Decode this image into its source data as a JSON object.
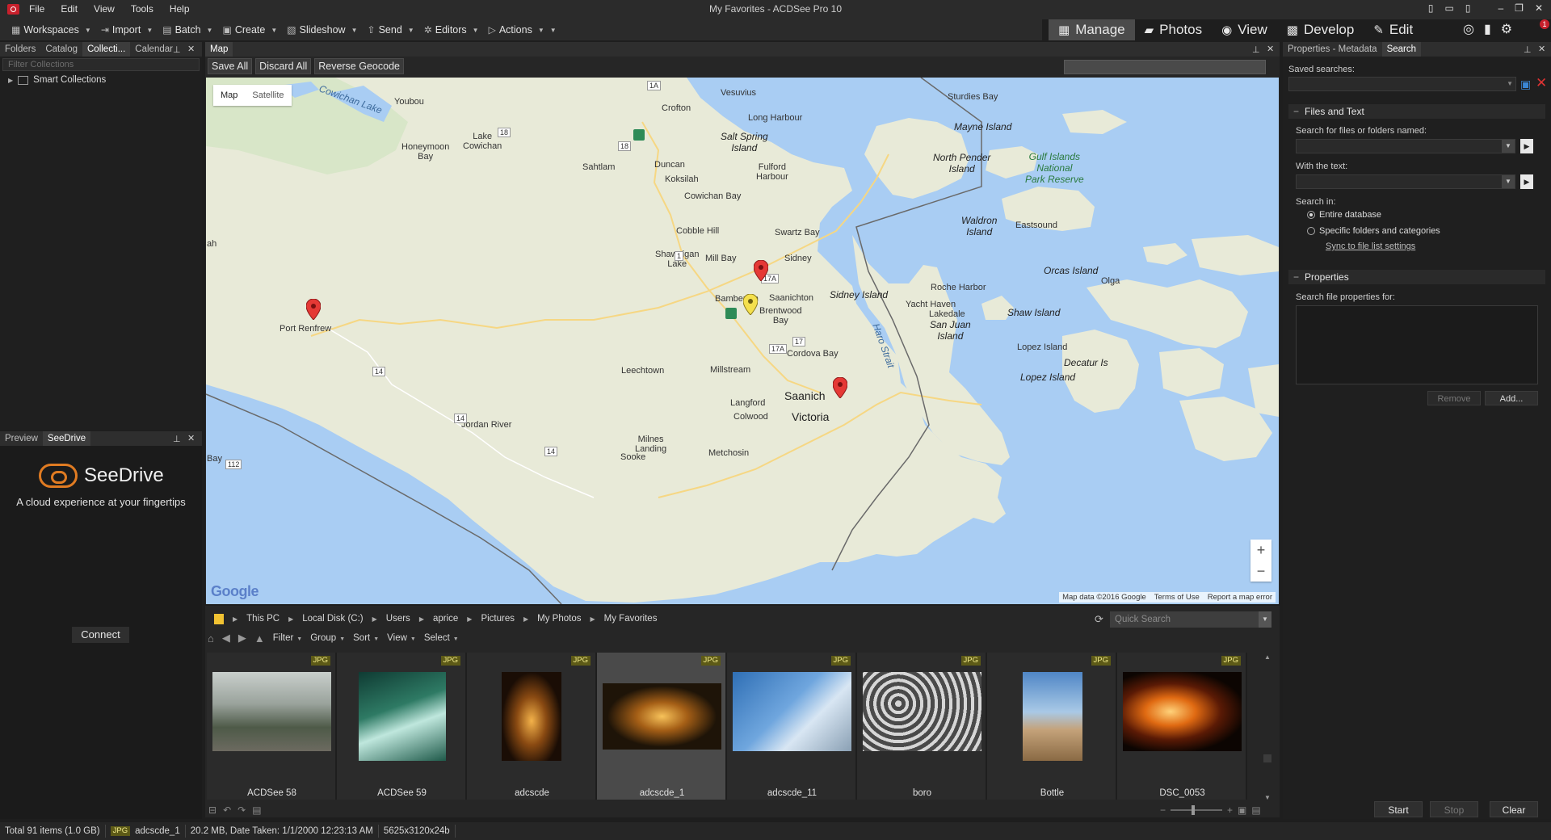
{
  "titlebar": {
    "title": "My Favorites - ACDSee Pro 10",
    "menu": [
      "File",
      "Edit",
      "View",
      "Tools",
      "Help"
    ]
  },
  "toolbar": {
    "items": [
      {
        "label": "Workspaces",
        "icon": "workspaces-icon"
      },
      {
        "label": "Import",
        "icon": "import-icon"
      },
      {
        "label": "Batch",
        "icon": "batch-icon"
      },
      {
        "label": "Create",
        "icon": "create-icon"
      },
      {
        "label": "Slideshow",
        "icon": "slideshow-icon"
      },
      {
        "label": "Send",
        "icon": "send-icon"
      },
      {
        "label": "Editors",
        "icon": "editors-icon"
      },
      {
        "label": "Actions",
        "icon": "actions-icon"
      }
    ]
  },
  "modes": [
    {
      "label": "Manage",
      "icon": "grid-icon",
      "active": true
    },
    {
      "label": "Photos",
      "icon": "photos-icon",
      "active": false
    },
    {
      "label": "View",
      "icon": "eye-icon",
      "active": false
    },
    {
      "label": "Develop",
      "icon": "develop-icon",
      "active": false
    },
    {
      "label": "Edit",
      "icon": "edit-icon",
      "active": false
    }
  ],
  "notification_count": "1",
  "left_top": {
    "tabs": [
      "Folders",
      "Catalog",
      "Collecti...",
      "Calendar"
    ],
    "active_tab": 2,
    "filter_placeholder": "Filter Collections",
    "tree_item": "Smart Collections"
  },
  "left_bottom": {
    "tabs": [
      "Preview",
      "SeeDrive"
    ],
    "active_tab": 1,
    "brand": "SeeDrive",
    "tagline": "A cloud experience at your fingertips",
    "connect_label": "Connect"
  },
  "map": {
    "panel_title": "Map",
    "actions": [
      "Save All",
      "Discard All",
      "Reverse Geocode"
    ],
    "map_types": [
      "Map",
      "Satellite"
    ],
    "zoom_in": "+",
    "zoom_out": "−",
    "logo": "Google",
    "attribution": [
      "Map data ©2016 Google",
      "Terms of Use",
      "Report a map error"
    ],
    "labels": {
      "youbou": "Youbou",
      "cowichan_lake_water": "Cowichan Lake",
      "lake_cowichan": "Lake\nCowichan",
      "honeymoon_bay": "Honeymoon\nBay",
      "crofton": "Crofton",
      "vesuvius": "Vesuvius",
      "sturdies_bay": "Sturdies Bay",
      "long_harbour": "Long Harbour",
      "mayne_island": "Mayne Island",
      "salt_spring": "Salt Spring\nIsland",
      "north_pender": "North Pender\nIsland",
      "gulf_islands": "Gulf Islands\nNational\nPark Reserve",
      "sahtlam": "Sahtlam",
      "duncan": "Duncan",
      "koksilah": "Koksilah",
      "fulford": "Fulford\nHarbour",
      "cowichan_bay": "Cowichan Bay",
      "waldron": "Waldron\nIsland",
      "eastsound": "Eastsound",
      "cobble_hill": "Cobble Hill",
      "swartz_bay": "Swartz Bay",
      "sidney": "Sidney",
      "shawnigan": "Shawnigan\nLake",
      "mill_bay": "Mill Bay",
      "orcas": "Orcas Island",
      "olga": "Olga",
      "roche": "Roche Harbor",
      "sidney_island": "Sidney Island",
      "saanichton": "Saanichton",
      "bamberton": "Bamberton",
      "brentwood": "Brentwood\nBay",
      "yacht_haven": "Yacht Haven",
      "port_renfrew": "Port Renfrew",
      "lakedale": "Lakedale",
      "san_juan": "San Juan\nIsland",
      "shaw": "Shaw Island",
      "cordova": "Cordova Bay",
      "haro": "Haro Strait",
      "lopez_island_n": "Lopez Island",
      "decatur": "Decatur Is",
      "lopez_island": "Lopez Island",
      "leechtown": "Leechtown",
      "millstream": "Millstream",
      "saanich": "Saanich",
      "langford": "Langford",
      "colwood": "Colwood",
      "victoria": "Victoria",
      "jordan_river": "Jordan River",
      "milnes": "Milnes\nLanding",
      "metchosin": "Metchosin",
      "sooke": "Sooke",
      "bay": "Bay",
      "ah": "ah"
    },
    "shields": [
      "1A",
      "18",
      "18",
      "1",
      "17A",
      "17",
      "17A",
      "14",
      "14",
      "14",
      "112"
    ]
  },
  "browser": {
    "breadcrumb": [
      "This PC",
      "Local Disk (C:)",
      "Users",
      "aprice",
      "Pictures",
      "My Photos",
      "My Favorites"
    ],
    "quick_search_placeholder": "Quick Search",
    "tools": [
      "Filter",
      "Group",
      "Sort",
      "View",
      "Select"
    ],
    "thumbnails": [
      {
        "name": "ACDSee 58",
        "type": "JPG",
        "selected": false
      },
      {
        "name": "ACDSee 59",
        "type": "JPG",
        "selected": false
      },
      {
        "name": "adcscde",
        "type": "JPG",
        "selected": false
      },
      {
        "name": "adcscde_1",
        "type": "JPG",
        "selected": true
      },
      {
        "name": "adcscde_11",
        "type": "JPG",
        "selected": false
      },
      {
        "name": "boro",
        "type": "JPG",
        "selected": false
      },
      {
        "name": "Bottle",
        "type": "JPG",
        "selected": false
      },
      {
        "name": "DSC_0053",
        "type": "JPG",
        "selected": false
      }
    ]
  },
  "right_panel": {
    "tabs": [
      "Properties - Metadata",
      "Search"
    ],
    "active_tab": 1,
    "saved_searches_label": "Saved searches:",
    "files_text_section": "Files and Text",
    "search_files_label": "Search for files or folders named:",
    "with_text_label": "With the text:",
    "search_in_label": "Search in:",
    "options": [
      "Entire database",
      "Specific folders and categories"
    ],
    "selected_option": 0,
    "sync_link": "Sync to file list settings",
    "properties_section": "Properties",
    "search_props_label": "Search file properties for:",
    "remove_label": "Remove",
    "add_label": "Add...",
    "start_label": "Start",
    "stop_label": "Stop",
    "clear_label": "Clear"
  },
  "status": {
    "total": "Total 91 items  (1.0 GB)",
    "file_type": "JPG",
    "file_name": "adcscde_1",
    "file_info": "20.2 MB, Date Taken: 1/1/2000 12:23:13 AM",
    "dimensions": "5625x3120x24b"
  },
  "colors": {
    "accent_red": "#c8202c",
    "jpg_badge": "#5d5a17",
    "map_water": "#a9cdf3",
    "map_land": "#e8ead8",
    "marker_red": "#e53935",
    "marker_yellow": "#f4e04d"
  }
}
